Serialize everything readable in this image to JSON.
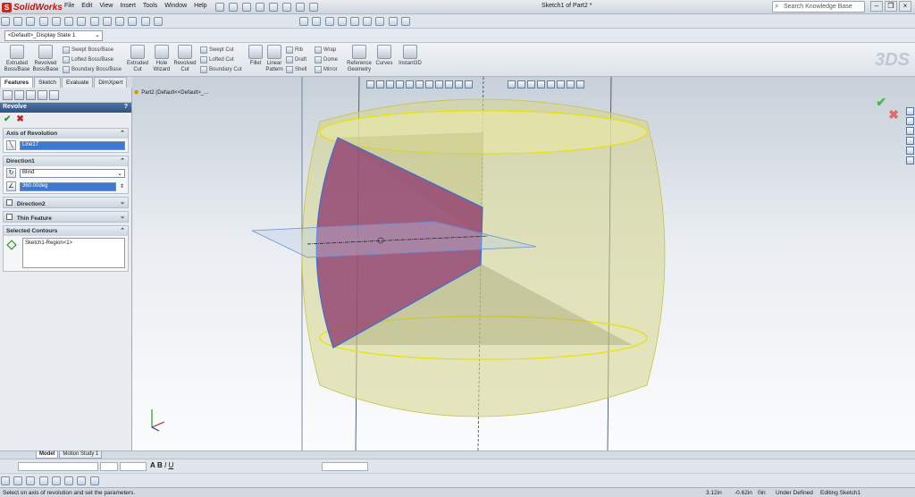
{
  "app": {
    "name": "SolidWorks",
    "logo_letter": "S"
  },
  "menu": [
    "File",
    "Edit",
    "View",
    "Insert",
    "Tools",
    "Window",
    "Help"
  ],
  "document_title": "Sketch1 of Part2 *",
  "search": {
    "placeholder": "Search Knowledge Base"
  },
  "config": {
    "value": "<Default>_Display State 1"
  },
  "commands": {
    "extruded_boss": "Extruded Boss/Base",
    "revolved_boss": "Revolved Boss/Base",
    "swept_boss": "Swept Boss/Base",
    "lofted_boss": "Lofted Boss/Base",
    "boundary_boss": "Boundary Boss/Base",
    "extruded_cut": "Extruded Cut",
    "hole_wizard": "Hole Wizard",
    "revolved_cut": "Revolved Cut",
    "swept_cut": "Swept Cut",
    "lofted_cut": "Lofted Cut",
    "boundary_cut": "Boundary Cut",
    "fillet": "Fillet",
    "linear_pattern": "Linear Pattern",
    "rib": "Rib",
    "draft": "Draft",
    "shell": "Shell",
    "wrap": "Wrap",
    "dome": "Dome",
    "mirror": "Mirror",
    "reference_geometry": "Reference Geometry",
    "curves": "Curves",
    "instant3d": "Instant3D"
  },
  "tabs": [
    "Features",
    "Sketch",
    "Evaluate",
    "DimXpert"
  ],
  "property_manager": {
    "title": "Revolve",
    "help": "?",
    "axis_group": {
      "title": "Axis of Revolution",
      "value": "Line17"
    },
    "direction1": {
      "title": "Direction1",
      "type": "Blind",
      "angle": "360.00deg"
    },
    "direction2": {
      "title": "Direction2"
    },
    "thin_feature": {
      "title": "Thin Feature"
    },
    "contours": {
      "title": "Selected Contours",
      "item": "Sketch1-Region<1>"
    }
  },
  "tree": {
    "label": "Part2 (Default<<Default>_..."
  },
  "model_tabs": [
    "Model",
    "Motion Study 1"
  ],
  "status": {
    "message": "Select on axis of revolution and set the parameters.",
    "x": "3.12in",
    "y": "-0.62in",
    "z": "0in",
    "state": "Under Defined",
    "editing": "Editing Sketch1"
  },
  "colors": {
    "accent": "#2e5283",
    "body_fill": "#d6d58a",
    "body_outline": "#e8e200",
    "profile_fill": "#8e3a6e",
    "sketch_line": "#3a6fd6"
  }
}
